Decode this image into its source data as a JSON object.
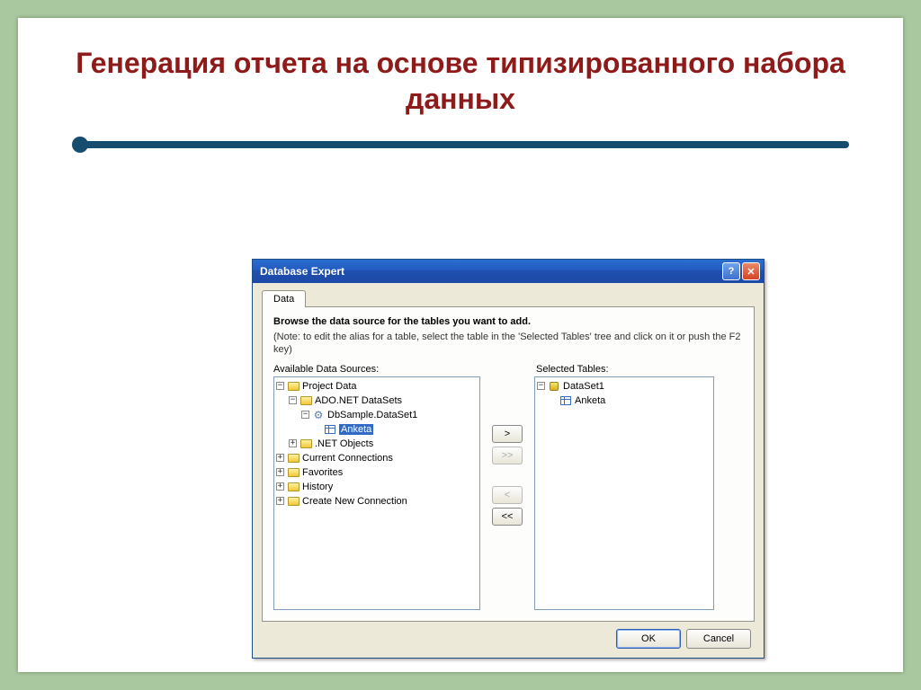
{
  "slide": {
    "title": "Генерация отчета на основе типизированного набора данных"
  },
  "dialog": {
    "title": "Database Expert",
    "tabs": {
      "data": "Data"
    },
    "instructions": {
      "bold": "Browse the data source for the tables you want to add.",
      "note": "(Note: to edit the alias for a table, select the table in the 'Selected Tables' tree and click on it or push the F2 key)"
    },
    "labels": {
      "available": "Available Data Sources:",
      "selected": "Selected Tables:"
    },
    "buttons": {
      "add": ">",
      "add_all": ">>",
      "remove": "<",
      "remove_all": "<<",
      "ok": "OK",
      "cancel": "Cancel"
    },
    "available_tree": {
      "project_data": "Project Data",
      "ado_net": "ADO.NET DataSets",
      "dbsample": "DbSample.DataSet1",
      "anketa": "Anketa",
      "net_objects": ".NET Objects",
      "current_conn": "Current Connections",
      "favorites": "Favorites",
      "history": "History",
      "create_new": "Create New Connection"
    },
    "selected_tree": {
      "dataset1": "DataSet1",
      "anketa": "Anketa"
    }
  }
}
